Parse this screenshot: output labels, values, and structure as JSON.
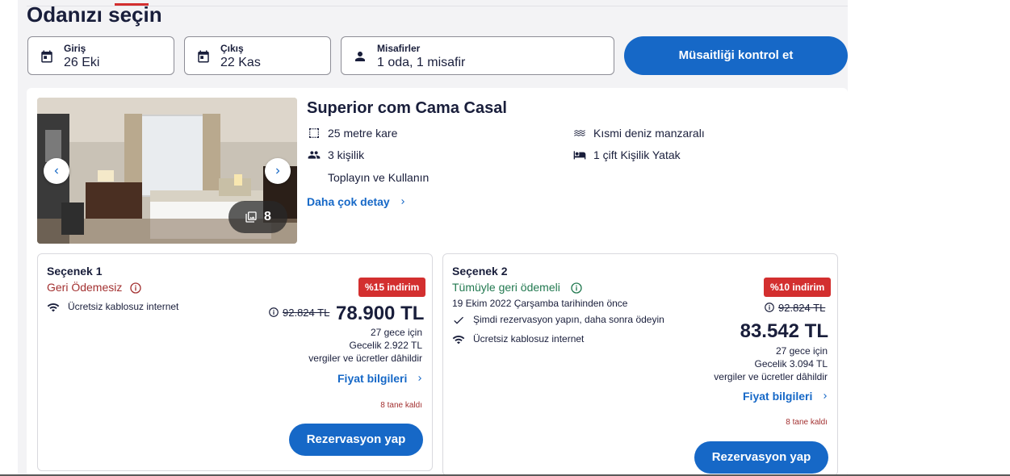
{
  "page": {
    "title": "Odanızı seçin"
  },
  "search": {
    "checkin_label": "Giriş",
    "checkin_value": "26 Eki",
    "checkout_label": "Çıkış",
    "checkout_value": "22 Kas",
    "guests_label": "Misafirler",
    "guests_value": "1 oda, 1 misafir",
    "check_button": "Müsaitliği kontrol et"
  },
  "room": {
    "name": "Superior com Cama Casal",
    "photo_count": "8",
    "features": {
      "size": "25 metre kare",
      "capacity": "3 kişilik",
      "extra": "Toplayın ve Kullanın",
      "view": "Kısmi deniz manzaralı",
      "bed": "1 çift Kişilik Yatak"
    },
    "more_details": "Daha çok detay",
    "brand_color": "#1668c7"
  },
  "options": [
    {
      "title": "Seçenek 1",
      "refund": "Geri Ödemesiz",
      "refund_color": "#a33131",
      "amenity": "Ücretsiz kablosuz internet",
      "discount": "%15 indirim",
      "old_price": "92.824 TL",
      "price": "78.900 TL",
      "nights": "27 gece için",
      "nightly": "Gecelik 2.922 TL",
      "taxes": "vergiler ve ücretler dâhildir",
      "price_info": "Fiyat bilgileri",
      "remaining": "8 tane kaldı",
      "book": "Rezervasyon yap"
    },
    {
      "title": "Seçenek 2",
      "refund": "Tümüyle geri ödemeli",
      "refund_color": "#227950",
      "refund_date": "19 Ekim 2022 Çarşamba tarihinden önce",
      "pay_later": "Şimdi rezervasyon yapın, daha sonra ödeyin",
      "amenity": "Ücretsiz kablosuz internet",
      "discount": "%10 indirim",
      "old_price": "92.824 TL",
      "price": "83.542 TL",
      "nights": "27 gece için",
      "nightly": "Gecelik 3.094 TL",
      "taxes": "vergiler ve ücretler dâhildir",
      "price_info": "Fiyat bilgileri",
      "remaining": "8 tane kaldı",
      "book": "Rezervasyon yap"
    }
  ]
}
